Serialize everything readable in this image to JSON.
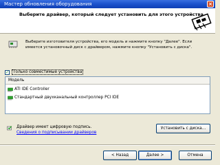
{
  "window": {
    "title": "Мастер обновления оборудования",
    "close_glyph": "×"
  },
  "header": {
    "title": "Выберите драйвер, который следует установить для этого устройства."
  },
  "info": {
    "line1": "Выберите изготовителя устройства, его модель и нажмите кнопку \"Далее\". Если",
    "line2": "имеется установочный диск с драйвером, нажмите кнопку \"Установить с диска\"."
  },
  "compat": {
    "checked": true,
    "check_glyph": "✓",
    "label": "Только совместимые устройства"
  },
  "list": {
    "column_header": "Модель",
    "items": [
      "ATI IDE Controller",
      "Стандартный двухканальный контроллер PCI IDE"
    ]
  },
  "signature": {
    "text": "Драйвер имеет цифровую подпись.",
    "link": "Сведения о подписывании драйверов"
  },
  "buttons": {
    "install_from_disk": "Установить с диска...",
    "back": "< Назад",
    "next": "Далее >",
    "cancel": "Отмена"
  },
  "colors": {
    "titlebar": "#1c52cc",
    "link": "#0000ff",
    "check_green": "#21a121"
  },
  "icons": {
    "header": "hardware-board-icon",
    "info": "device-card-icon",
    "item": "controller-device-icon",
    "signature": "signed-driver-icon"
  }
}
